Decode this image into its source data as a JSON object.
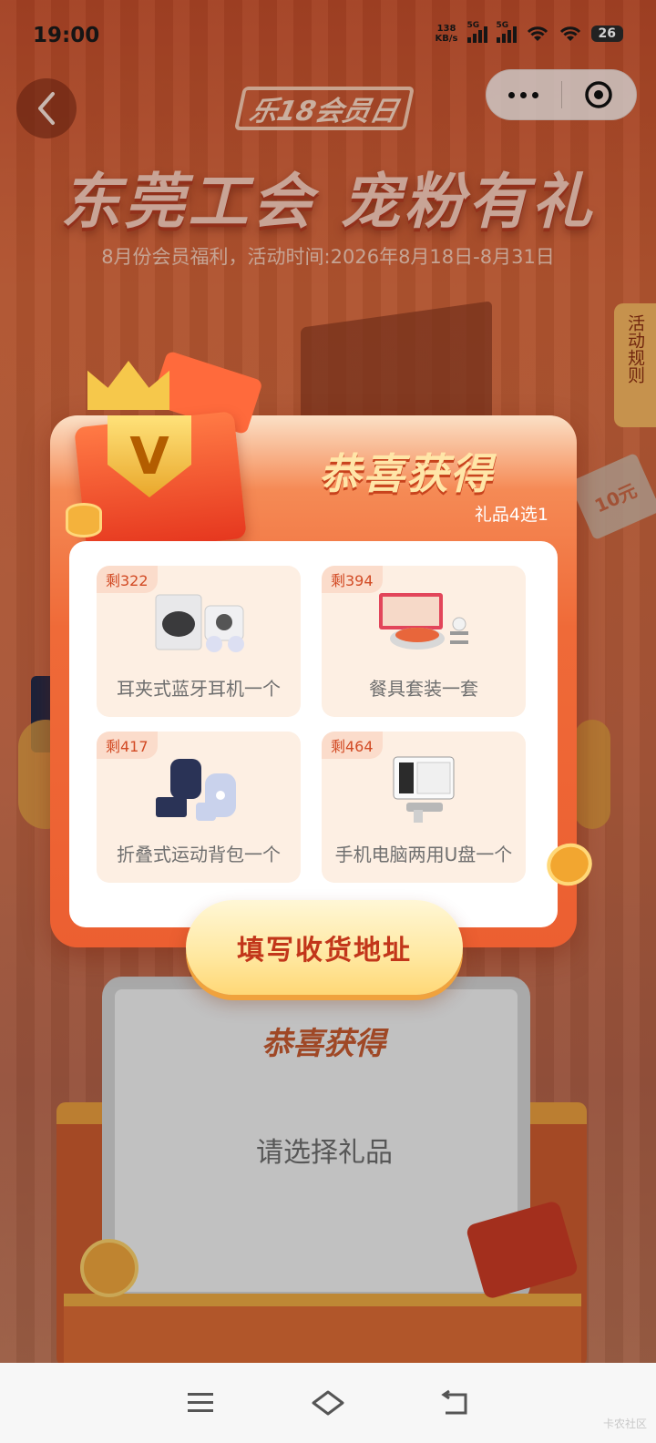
{
  "status_bar": {
    "time": "19:00",
    "net_speed": "138",
    "net_unit": "KB/s",
    "sim1": "5G",
    "sim2": "5G",
    "battery": "26"
  },
  "header": {
    "brand": "乐18会员日",
    "title": "东莞工会 宠粉有礼",
    "subtitle": "8月份会员福利，活动时间:2026年8月18日-8月31日"
  },
  "rules_tab": {
    "label": "活动规则"
  },
  "decor": {
    "ticket": "10元"
  },
  "modal": {
    "title": "恭喜获得",
    "subtitle": "礼品4选1",
    "gifts": [
      {
        "stock": "剩322",
        "name": "耳夹式蓝牙耳机一个"
      },
      {
        "stock": "剩394",
        "name": "餐具套装一套"
      },
      {
        "stock": "剩417",
        "name": "折叠式运动背包一个"
      },
      {
        "stock": "剩464",
        "name": "手机电脑两用U盘一个"
      }
    ],
    "cta_label": "填写收货地址"
  },
  "result_card": {
    "title": "恭喜获得",
    "prompt": "请选择礼品"
  },
  "watermark": "卡农社区",
  "colors": {
    "primary": "#ec5f31",
    "accent_gold": "#ffe8a0",
    "cta_text": "#c2361a"
  }
}
